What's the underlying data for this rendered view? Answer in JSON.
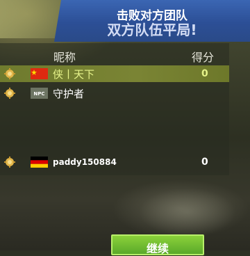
{
  "banner": {
    "title": "击败对方团队",
    "subtitle": "双方队伍平局!"
  },
  "table": {
    "header_name": "昵称",
    "header_score": "得分",
    "rows": [
      {
        "name": "侠丨天下",
        "score": "0",
        "flag": "china-flag-icon",
        "highlight": true
      },
      {
        "name": "守护者",
        "score": "",
        "flag": "npc-badge-icon",
        "highlight": false,
        "npc_label": "NPC"
      },
      {
        "name": "paddy150884",
        "score": "0",
        "flag": "germany-flag-icon",
        "highlight": false
      }
    ]
  },
  "continue_button": {
    "label": "继续"
  },
  "colors": {
    "banner_blue": "#2c4f96",
    "highlight_green": "#7a8434",
    "button_green": "#5aa92a",
    "self_text": "#e6f38a"
  }
}
